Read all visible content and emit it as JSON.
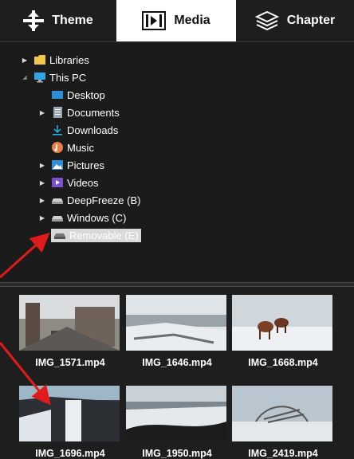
{
  "tabs": [
    {
      "label": "Theme",
      "icon": "theme-icon"
    },
    {
      "label": "Media",
      "icon": "media-icon",
      "active": true
    },
    {
      "label": "Chapter",
      "icon": "layers-icon"
    }
  ],
  "tree": {
    "libraries": "Libraries",
    "this_pc": "This PC",
    "desktop": "Desktop",
    "documents": "Documents",
    "downloads": "Downloads",
    "music": "Music",
    "pictures": "Pictures",
    "videos": "Videos",
    "deepfreeze": "DeepFreeze (B)",
    "windows": "Windows (C)",
    "removable": "Removable (E)"
  },
  "media": [
    {
      "name": "IMG_1571.mp4"
    },
    {
      "name": "IMG_1646.mp4"
    },
    {
      "name": "IMG_1668.mp4"
    },
    {
      "name": "IMG_1696.mp4"
    },
    {
      "name": "IMG_1950.mp4"
    },
    {
      "name": "IMG_2419.mp4"
    }
  ],
  "colors": {
    "annotation_arrow": "#e01b1b",
    "folder": "#f3c54a",
    "pc_blue": "#2ea6e8"
  }
}
